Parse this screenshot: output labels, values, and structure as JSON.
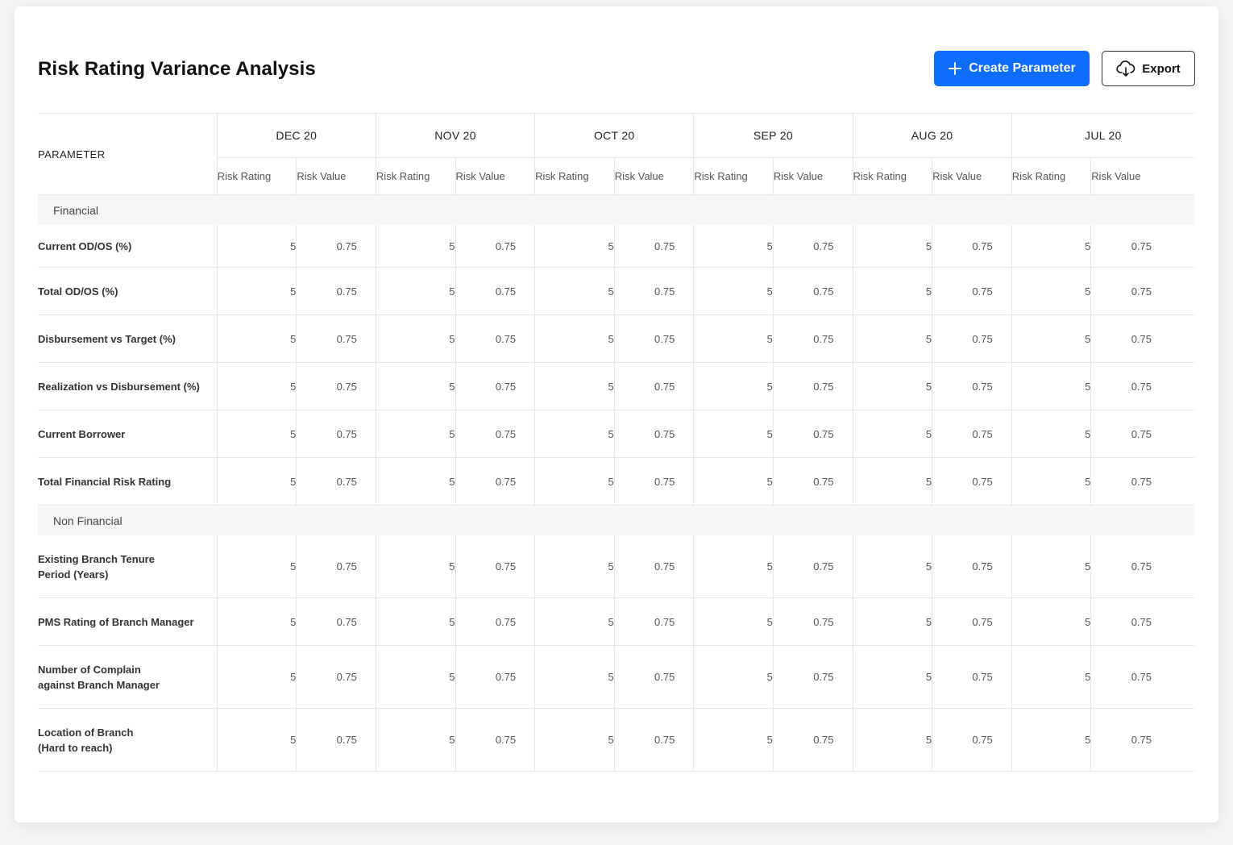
{
  "title": "Risk Rating Variance Analysis",
  "actions": {
    "create_label": "Create Parameter",
    "export_label": "Export",
    "create_icon": "plus-icon",
    "export_icon": "cloud-download-icon",
    "accent_color": "#0d6efd"
  },
  "table": {
    "parameter_header": "PARAMETER",
    "months": [
      "DEC 20",
      "NOV 20",
      "OCT 20",
      "SEP 20",
      "AUG 20",
      "JUL 20"
    ],
    "sub_headers": {
      "rating": "Risk Rating",
      "value": "Risk Value"
    },
    "sections": [
      {
        "name": "Financial",
        "rows": [
          {
            "lines": [
              "Current OD/OS (%)"
            ],
            "rating": "5",
            "value": "0.75"
          },
          {
            "lines": [
              "Total OD/OS (%)"
            ],
            "rating": "5",
            "value": "0.75"
          },
          {
            "lines": [
              "Disbursement vs Target (%)"
            ],
            "rating": "5",
            "value": "0.75"
          },
          {
            "lines": [
              "Realization vs Disbursement (%)"
            ],
            "rating": "5",
            "value": "0.75"
          },
          {
            "lines": [
              "Current Borrower"
            ],
            "rating": "5",
            "value": "0.75"
          },
          {
            "lines": [
              "Total Financial Risk Rating"
            ],
            "rating": "5",
            "value": "0.75"
          }
        ]
      },
      {
        "name": "Non Financial",
        "rows": [
          {
            "lines": [
              "Existing Branch Tenure",
              "Period (Years)"
            ],
            "rating": "5",
            "value": "0.75"
          },
          {
            "lines": [
              "PMS Rating of Branch Manager"
            ],
            "rating": "5",
            "value": "0.75"
          },
          {
            "lines": [
              "Number of Complain",
              "against Branch Manager"
            ],
            "rating": "5",
            "value": "0.75"
          },
          {
            "lines": [
              "Location of Branch",
              "(Hard to reach)"
            ],
            "rating": "5",
            "value": "0.75"
          }
        ]
      }
    ]
  }
}
